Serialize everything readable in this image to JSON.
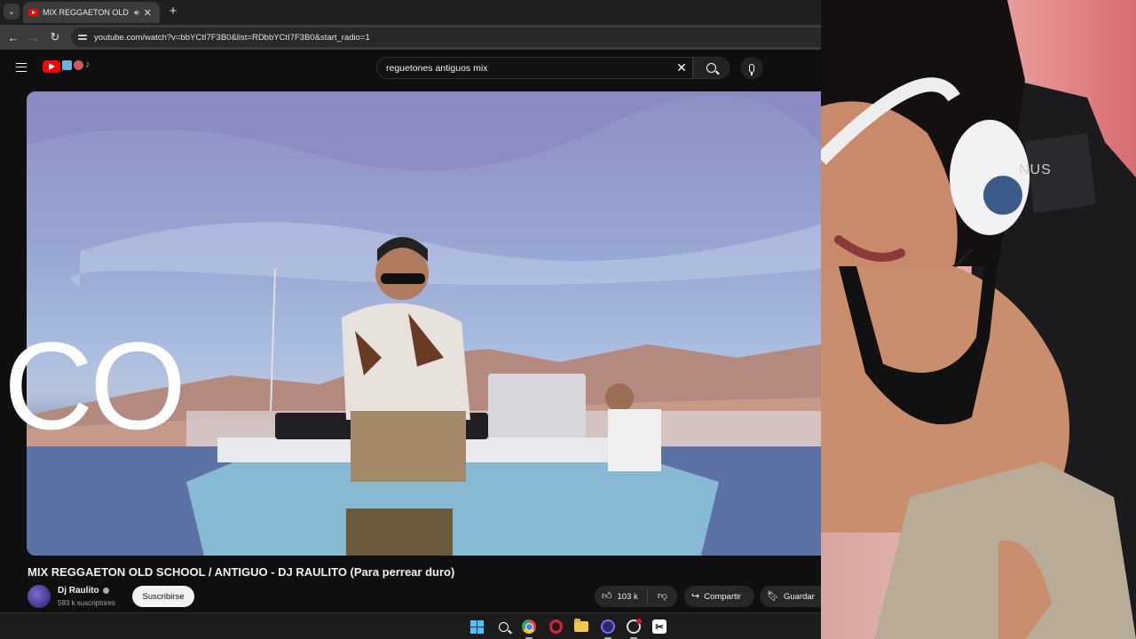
{
  "browser": {
    "tab_title": "MIX REGGAETON OLD SCHO",
    "url": "youtube.com/watch?v=bbYCtI7F3B0&list=RDbbYCtI7F3B0&start_radio=1"
  },
  "youtube": {
    "search_query": "reguetones antiguos mix",
    "overlay_text": "CO",
    "video_title": "MIX REGGAETON OLD SCHOOL / ANTIGUO - DJ RAULITO (Para perrear duro)",
    "channel_name": "Dj Raulito",
    "subscribers": "593 k suscriptores",
    "subscribe_label": "Suscribirse",
    "like_count": "103 k",
    "share_label": "Compartir",
    "save_label": "Guardar"
  },
  "webcam": {
    "chair_text": "NUS"
  },
  "icons": {
    "brand": "#ff0000",
    "windows": "#4cc2ff"
  }
}
